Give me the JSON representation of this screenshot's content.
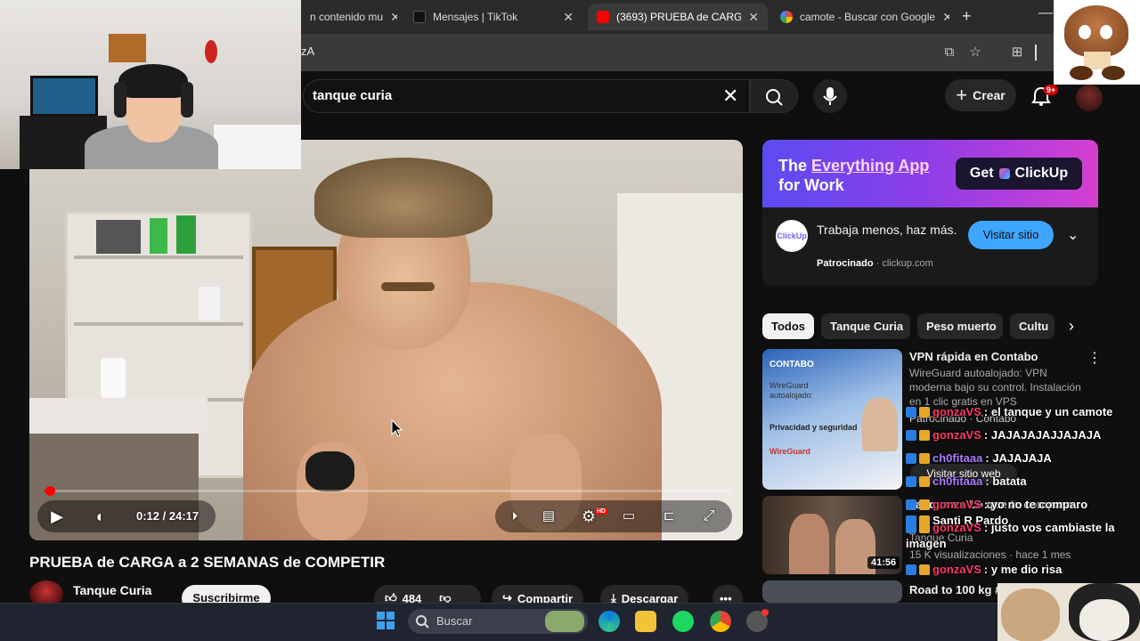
{
  "browser": {
    "tabs": [
      {
        "label": "n contenido mu",
        "active": false
      },
      {
        "label": "Mensajes | TikTok",
        "active": false
      },
      {
        "label": "(3693) PRUEBA de CARGA a",
        "active": true
      },
      {
        "label": "camote - Buscar con Google",
        "active": false
      }
    ],
    "url_fragment": "zA",
    "new_tab": "+"
  },
  "youtube": {
    "search_value": "tanque curia",
    "create_label": "Crear",
    "notifications_badge": "9+"
  },
  "player": {
    "time": "0:12 / 24:17",
    "progress": 0.008,
    "title": "PRUEBA de CARGA a 2 SEMANAS de COMPETIR",
    "channel": "Tanque Curia",
    "subscribe_label": "Suscribirme",
    "likes": "484",
    "share_label": "Compartir",
    "download_label": "Descargar",
    "hd_badge": "HD"
  },
  "ad": {
    "headline_1": "The ",
    "headline_hl": "Everything App",
    "headline_2": " for Work",
    "get_label": "Get",
    "brand": "ClickUp",
    "logo_text": "ClickUp",
    "text": "Trabaja menos, haz más.",
    "sponsored": "Patrocinado",
    "domain": "clickup.com",
    "visit_label": "Visitar sitio"
  },
  "chips": [
    "Todos",
    "Tanque Curia",
    "Peso muerto",
    "Cultu"
  ],
  "recs": [
    {
      "title": "VPN rápida en Contabo",
      "desc": "WireGuard autoalojado: VPN moderna bajo su control. Instalación en 1 clic gratis en VPS",
      "sponsor": "Patrocinado · Contabo",
      "visit": "Visitar sitio web",
      "thumb_brand": "CONTABO",
      "thumb_text_1": "WireGuard autoalojado:",
      "thumb_text_2": "Privacidad y seguridad",
      "thumb_logo": "WireGuard"
    },
    {
      "title": "Tanque vs Lo que te comparo",
      "channel": "Tanque Curia",
      "meta": "15 K visualizaciones · hace 1 mes",
      "duration": "41:56"
    },
    {
      "title": "Road to 100 kg #3"
    }
  ],
  "chat": [
    {
      "user": "gonzaVS",
      "msg": ": el tanque y un camote"
    },
    {
      "user": "gonzaVS",
      "msg": ": JAJAJAJAJJAJAJA"
    },
    {
      "user": "ch0fitaaa",
      "msg": ": JAJAJAJA"
    },
    {
      "user": "ch0fitaaa",
      "msg": ": batata"
    },
    {
      "user": "gonzaVS",
      "msg": ": yo no te comparo"
    },
    {
      "user": "Santi R Pardo",
      "msg": ""
    },
    {
      "user": "gonzaVS",
      "msg": ": justo vos cambiaste la"
    },
    {
      "user": "",
      "msg": "imagen"
    },
    {
      "user": "gonzaVS",
      "msg": ": y me dio risa"
    }
  ],
  "taskbar": {
    "search_placeholder": "Buscar"
  }
}
